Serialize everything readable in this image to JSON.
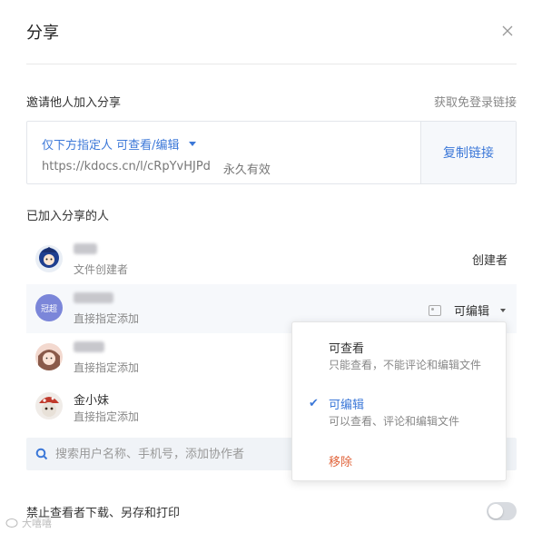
{
  "dialog": {
    "title": "分享"
  },
  "invite": {
    "title": "邀请他人加入分享",
    "free_login_link": "获取免登录链接",
    "permission_label": "仅下方指定人 可查看/编辑",
    "url": "https://kdocs.cn/l/cRpYvHJPd",
    "validity": "永久有效",
    "copy_button": "复制链接"
  },
  "members_section": {
    "title": "已加入分享的人"
  },
  "members": [
    {
      "sub": "文件创建者",
      "role": "创建者"
    },
    {
      "avatar_text": "冠超",
      "sub": "直接指定添加",
      "role": "可编辑"
    },
    {
      "sub": "直接指定添加"
    },
    {
      "name": "金小妹",
      "sub": "直接指定添加"
    }
  ],
  "search": {
    "placeholder": "搜索用户名称、手机号，添加协作者"
  },
  "download": {
    "label": "禁止查看者下载、另存和打印",
    "enabled": false
  },
  "watermark": {
    "text": "大嘻嘻"
  },
  "dropdown": {
    "options": [
      {
        "title": "可查看",
        "desc": "只能查看，不能评论和编辑文件",
        "selected": false
      },
      {
        "title": "可编辑",
        "desc": "可以查看、评论和编辑文件",
        "selected": true
      }
    ],
    "remove": "移除"
  },
  "colors": {
    "accent": "#3c78d8",
    "danger": "#e0643b",
    "avatar_purple": "#7b86d9"
  },
  "icons": {
    "close": "close-icon",
    "caret": "caret-down-icon",
    "search": "search-icon",
    "check": "check-icon",
    "contact": "contact-card-icon"
  }
}
